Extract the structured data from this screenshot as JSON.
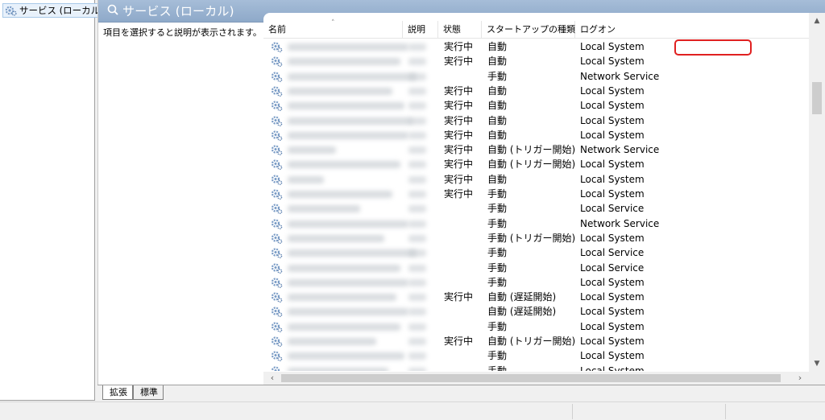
{
  "tree": {
    "root_label": "サービス (ローカル)"
  },
  "header": {
    "title": "サービス (ローカル)"
  },
  "description_pane": {
    "text": "項目を選択すると説明が表示されます。"
  },
  "columns": {
    "name": "名前",
    "description": "説明",
    "status": "状態",
    "startup": "スタートアップの種類",
    "logon": "ログオン"
  },
  "sort_indicator": "˄",
  "rows": [
    {
      "status": "実行中",
      "startup": "自動",
      "logon": "Local System"
    },
    {
      "status": "実行中",
      "startup": "自動",
      "logon": "Local System"
    },
    {
      "status": "",
      "startup": "手動",
      "logon": "Network Service"
    },
    {
      "status": "実行中",
      "startup": "自動",
      "logon": "Local System"
    },
    {
      "status": "実行中",
      "startup": "自動",
      "logon": "Local System"
    },
    {
      "status": "実行中",
      "startup": "自動",
      "logon": "Local System"
    },
    {
      "status": "実行中",
      "startup": "自動",
      "logon": "Local System"
    },
    {
      "status": "実行中",
      "startup": "自動 (トリガー開始)",
      "logon": "Network Service"
    },
    {
      "status": "実行中",
      "startup": "自動 (トリガー開始)",
      "logon": "Local System"
    },
    {
      "status": "実行中",
      "startup": "自動",
      "logon": "Local System"
    },
    {
      "status": "実行中",
      "startup": "手動",
      "logon": "Local System"
    },
    {
      "status": "",
      "startup": "手動",
      "logon": "Local Service"
    },
    {
      "status": "",
      "startup": "手動",
      "logon": "Network Service"
    },
    {
      "status": "",
      "startup": "手動 (トリガー開始)",
      "logon": "Local System"
    },
    {
      "status": "",
      "startup": "手動",
      "logon": "Local Service"
    },
    {
      "status": "",
      "startup": "手動",
      "logon": "Local Service"
    },
    {
      "status": "",
      "startup": "手動",
      "logon": "Local System"
    },
    {
      "status": "実行中",
      "startup": "自動 (遅延開始)",
      "logon": "Local System"
    },
    {
      "status": "",
      "startup": "自動 (遅延開始)",
      "logon": "Local System"
    },
    {
      "status": "",
      "startup": "手動",
      "logon": "Local System"
    },
    {
      "status": "実行中",
      "startup": "自動 (トリガー開始)",
      "logon": "Local System"
    },
    {
      "status": "",
      "startup": "手動",
      "logon": "Local System"
    },
    {
      "status": "",
      "startup": "手動",
      "logon": "Local System"
    }
  ],
  "tabs": {
    "extended": "拡張",
    "standard": "標準"
  },
  "colors": {
    "header_blue": "#8ea9c9",
    "highlight_red": "#e02020",
    "gear_blue": "#7a9cc6"
  },
  "icons": {
    "service": "gear-icon",
    "scroll_up": "▲",
    "scroll_down": "▼",
    "scroll_left": "‹",
    "scroll_right": "›",
    "search": "magnifier-icon"
  }
}
